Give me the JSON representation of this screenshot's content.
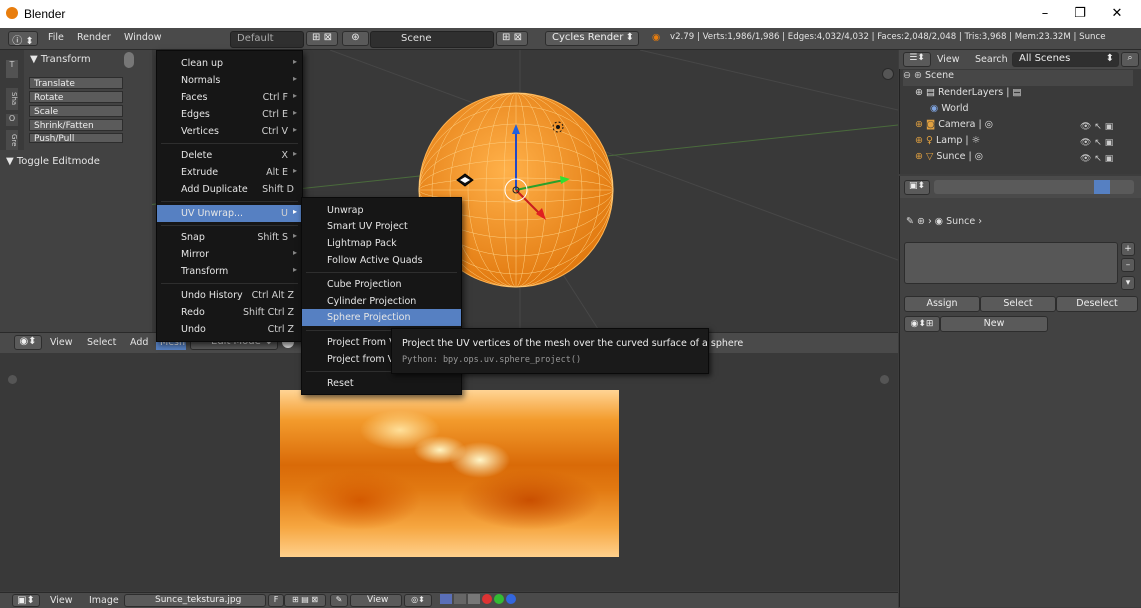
{
  "window": {
    "title": "Blender",
    "controls": [
      "–",
      "❐",
      "✕"
    ]
  },
  "infobar": {
    "menus": [
      "File",
      "Render",
      "Window"
    ],
    "layout": "Default",
    "scene": "Scene",
    "engine": "Cycles Render",
    "stats": "v2.79 | Verts:1,986/1,986 | Edges:4,032/4,032 | Faces:2,048/2,048 | Tris:3,968 | Mem:23.32M | Sunce"
  },
  "toolshelf": {
    "panel_title": "▼ Transform",
    "tools": [
      "Translate",
      "Rotate",
      "Scale",
      "Shrink/Fatten",
      "Push/Pull"
    ],
    "toggle": "▼ Toggle Editmode",
    "tabs": [
      "T",
      "Sha",
      "O",
      "Gre"
    ]
  },
  "mesh_menu": {
    "items": [
      {
        "label": "Clean up",
        "shortcut": "",
        "arrow": true
      },
      {
        "label": "Normals",
        "shortcut": "",
        "arrow": true
      },
      {
        "label": "Faces",
        "shortcut": "Ctrl F",
        "arrow": true
      },
      {
        "label": "Edges",
        "shortcut": "Ctrl E",
        "arrow": true
      },
      {
        "label": "Vertices",
        "shortcut": "Ctrl V",
        "arrow": true
      },
      {
        "label": "Delete",
        "shortcut": "X",
        "arrow": true
      },
      {
        "label": "Extrude",
        "shortcut": "Alt E",
        "arrow": true
      },
      {
        "label": "Add Duplicate",
        "shortcut": "Shift D",
        "arrow": false
      },
      {
        "label": "UV Unwrap...",
        "shortcut": "U",
        "arrow": true
      },
      {
        "label": "Snap",
        "shortcut": "Shift S",
        "arrow": true
      },
      {
        "label": "Mirror",
        "shortcut": "",
        "arrow": true
      },
      {
        "label": "Transform",
        "shortcut": "",
        "arrow": true
      },
      {
        "label": "Undo History",
        "shortcut": "Ctrl Alt Z",
        "arrow": false
      },
      {
        "label": "Redo",
        "shortcut": "Shift Ctrl Z",
        "arrow": false
      },
      {
        "label": "Undo",
        "shortcut": "Ctrl Z",
        "arrow": false
      }
    ]
  },
  "uv_menu": {
    "items": [
      {
        "label": "Unwrap"
      },
      {
        "label": "Smart UV Project"
      },
      {
        "label": "Lightmap Pack"
      },
      {
        "label": "Follow Active Quads"
      },
      {
        "label": "Cube Projection"
      },
      {
        "label": "Cylinder Projection"
      },
      {
        "label": "Sphere Projection"
      },
      {
        "label": "Project From Vi"
      },
      {
        "label": "Project from Vie"
      },
      {
        "label": "Reset"
      }
    ]
  },
  "tooltip": {
    "text": "Project the UV vertices of the mesh over the curved surface of a sphere",
    "python": "Python: bpy.ops.uv.sphere_project()"
  },
  "view3d_header": {
    "menus": [
      "View",
      "Select",
      "Add",
      "Mesh"
    ],
    "mode": "Edit Mode"
  },
  "image_header": {
    "menus": [
      "View",
      "Image"
    ],
    "image_name": "Sunce_tekstura.jpg",
    "f_label": "F",
    "view_label": "View"
  },
  "outliner": {
    "menus": [
      "View",
      "Search"
    ],
    "filter": "All Scenes",
    "rows": [
      "Scene",
      "RenderLayers",
      "World",
      "Camera",
      "Lamp",
      "Sunce"
    ]
  },
  "properties": {
    "breadcrumb": "Sunce",
    "buttons": [
      "Assign",
      "Select",
      "Deselect"
    ],
    "new_label": "New"
  },
  "colors": {
    "menu_highlight": "#5680c2",
    "sphere_wire": "#f28c1e",
    "bg": "#393939"
  }
}
